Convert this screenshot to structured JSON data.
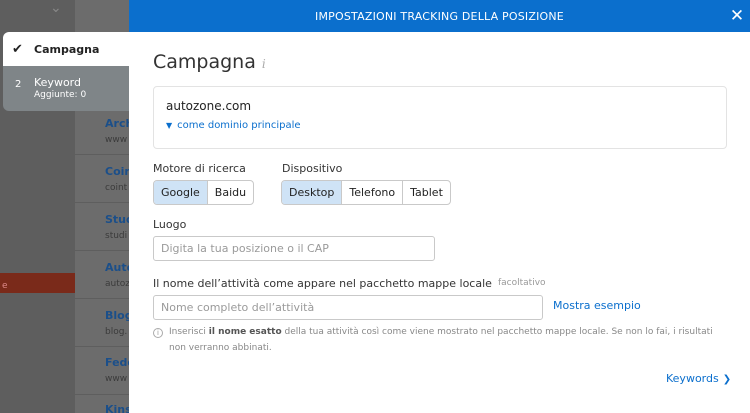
{
  "background": {
    "items": [
      {
        "title": "Arch",
        "sub": "www"
      },
      {
        "title": "Coin",
        "sub": "coint"
      },
      {
        "title": "Stud",
        "sub": "studi"
      },
      {
        "title": "Auto",
        "sub": "autoz"
      },
      {
        "title": "Blog",
        "sub": "blog."
      },
      {
        "title": "Fede",
        "sub": "www"
      },
      {
        "title": "Kins",
        "sub": ""
      }
    ],
    "red_bar_text": "e"
  },
  "steps": [
    {
      "label": "Campagna",
      "state": "done"
    },
    {
      "number": "2",
      "label": "Keyword",
      "sub": "Aggiunte: 0",
      "state": "pending"
    }
  ],
  "modal": {
    "title": "IMPOSTAZIONI TRACKING DELLA POSIZIONE",
    "heading": "Campagna",
    "info_icon": "i",
    "domain": {
      "value": "autozone.com",
      "link_label": "come dominio principale"
    },
    "search_engine": {
      "label": "Motore di ricerca",
      "options": [
        "Google",
        "Baidu"
      ],
      "selected": "Google"
    },
    "device": {
      "label": "Dispositivo",
      "options": [
        "Desktop",
        "Telefono",
        "Tablet"
      ],
      "selected": "Desktop"
    },
    "location": {
      "label": "Luogo",
      "placeholder": "Digita la tua posizione o il CAP",
      "value": ""
    },
    "business_name": {
      "label": "Il nome dell’attività come appare nel pacchetto mappe locale",
      "optional_label": "facoltativo",
      "placeholder": "Nome completo dell’attività",
      "value": "",
      "example_link": "Mostra esempio"
    },
    "hint": {
      "icon": "i",
      "prefix": "Inserisci ",
      "bold": "il nome esatto",
      "suffix": " della tua attività così come viene mostrato nel pacchetto mappe locale. Se non lo fai, i risultati non verranno abbinati."
    },
    "next_label": "Keywords"
  },
  "colors": {
    "accent": "#0b6fcd",
    "selected_bg": "#cfe3f6"
  }
}
